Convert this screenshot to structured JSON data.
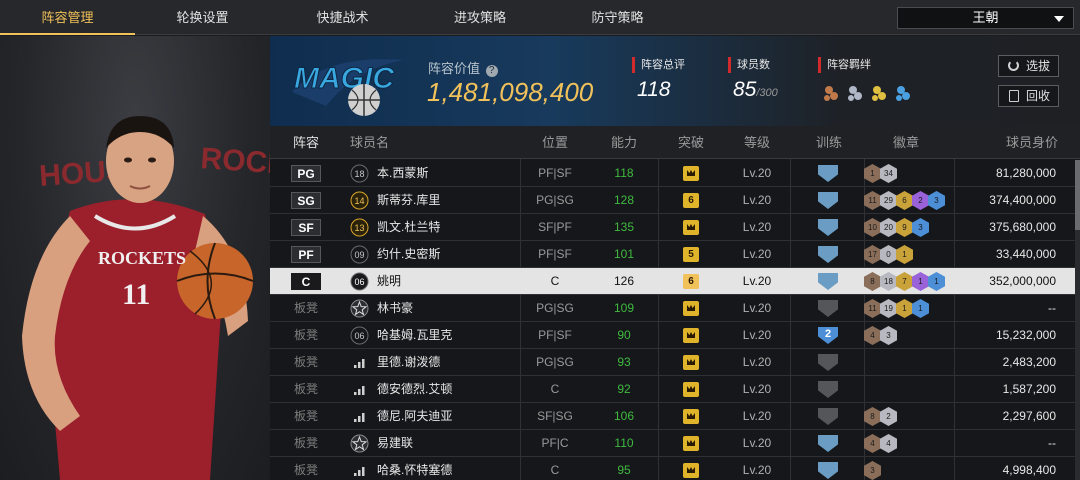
{
  "tabs": [
    {
      "label": "阵容管理",
      "active": true
    },
    {
      "label": "轮换设置",
      "active": false
    },
    {
      "label": "快捷战术",
      "active": false
    },
    {
      "label": "进攻策略",
      "active": false
    },
    {
      "label": "防守策略",
      "active": false
    }
  ],
  "team_select": {
    "value": "王朝"
  },
  "player_art": {
    "jersey_team": "ROCKETS",
    "jersey_number": "11",
    "backdrop_text_left": "HOUST",
    "backdrop_text_right": "ROCK"
  },
  "header": {
    "logo_text": "MAGIC",
    "lineup_value_label": "阵容价值",
    "lineup_value": "1,481,098,400",
    "total_rating_label": "阵容总评",
    "total_rating": "118",
    "player_count_label": "球员数",
    "player_count": "85",
    "player_count_max": "/300",
    "bonds_label": "阵容羁绊",
    "scout_button": "选拔",
    "recycle_button": "回收"
  },
  "columns": [
    "阵容",
    "球员名",
    "位置",
    "能力",
    "突破",
    "等级",
    "训练",
    "徽章",
    "球员身价"
  ],
  "rows": [
    {
      "slot": "PG",
      "num": "18",
      "name": "本.西蒙斯",
      "pos": "PF|SF",
      "ability": "118",
      "breakthrough": "",
      "level": "Lv.20",
      "training": "",
      "badges": [
        "1",
        "34"
      ],
      "value": "81,280,000",
      "selected": false,
      "starter": true,
      "num_style": "plain",
      "break_color": "#e0b42a",
      "train_color": "#6a9cc4",
      "badge_colors": [
        "#8a6e5a",
        "#b8b8c0"
      ]
    },
    {
      "slot": "SG",
      "num": "14",
      "name": "斯蒂芬.库里",
      "pos": "PG|SG",
      "ability": "128",
      "breakthrough": "6",
      "level": "Lv.20",
      "training": "",
      "badges": [
        "11",
        "29",
        "6",
        "2",
        "3"
      ],
      "value": "374,400,000",
      "selected": false,
      "starter": true,
      "num_style": "gold",
      "break_color": "#e0b42a",
      "train_color": "#6a9cc4",
      "badge_colors": [
        "#8a6e5a",
        "#b8b8c0",
        "#c9a23a",
        "#9a62d8",
        "#4c8fd6"
      ]
    },
    {
      "slot": "SF",
      "num": "13",
      "name": "凯文.杜兰特",
      "pos": "SF|PF",
      "ability": "135",
      "breakthrough": "",
      "level": "Lv.20",
      "training": "",
      "badges": [
        "10",
        "20",
        "9",
        "3"
      ],
      "value": "375,680,000",
      "selected": false,
      "starter": true,
      "num_style": "gold",
      "break_color": "#e0b42a",
      "train_color": "#6a9cc4",
      "badge_colors": [
        "#8a6e5a",
        "#b8b8c0",
        "#c9a23a",
        "#4c8fd6"
      ]
    },
    {
      "slot": "PF",
      "num": "09",
      "name": "约什.史密斯",
      "pos": "PF|SF",
      "ability": "101",
      "breakthrough": "5",
      "level": "Lv.20",
      "training": "",
      "badges": [
        "17",
        "0",
        "1"
      ],
      "value": "33,440,000",
      "selected": false,
      "starter": true,
      "num_style": "plain",
      "break_color": "#e0b42a",
      "train_color": "#6a9cc4",
      "badge_colors": [
        "#8a6e5a",
        "#b8b8c0",
        "#c9a23a"
      ]
    },
    {
      "slot": "C",
      "num": "06",
      "name": "姚明",
      "pos": "C",
      "ability": "126",
      "breakthrough": "6",
      "level": "Lv.20",
      "training": "",
      "badges": [
        "8",
        "18",
        "7",
        "1",
        "1"
      ],
      "value": "352,000,000",
      "selected": true,
      "starter": true,
      "num_style": "dark",
      "break_color": "#e0b42a",
      "train_color": "#6a9cc4",
      "badge_colors": [
        "#8a6e5a",
        "#b8b8c0",
        "#c9a23a",
        "#9a62d8",
        "#4c8fd6"
      ]
    },
    {
      "slot": "板凳",
      "num": "",
      "name": "林书豪",
      "pos": "PG|SG",
      "ability": "109",
      "breakthrough": "",
      "level": "Lv.20",
      "training": "",
      "badges": [
        "11",
        "19",
        "1",
        "1"
      ],
      "value": "--",
      "selected": false,
      "starter": false,
      "num_style": "star",
      "break_color": "#e0b42a",
      "train_color": "#555659",
      "badge_colors": [
        "#8a6e5a",
        "#b8b8c0",
        "#c9a23a",
        "#4c8fd6"
      ]
    },
    {
      "slot": "板凳",
      "num": "06",
      "name": "哈基姆.瓦里克",
      "pos": "PF|SF",
      "ability": "90",
      "breakthrough": "",
      "level": "Lv.20",
      "training": "2",
      "badges": [
        "4",
        "3"
      ],
      "value": "15,232,000",
      "selected": false,
      "starter": false,
      "num_style": "plain",
      "break_color": "#e0b42a",
      "train_color": "#4c8fd6",
      "badge_colors": [
        "#8a6e5a",
        "#b8b8c0"
      ]
    },
    {
      "slot": "板凳",
      "num": "",
      "name": "里德.谢泼德",
      "pos": "PG|SG",
      "ability": "93",
      "breakthrough": "",
      "level": "Lv.20",
      "training": "",
      "badges": [],
      "value": "2,483,200",
      "selected": false,
      "starter": false,
      "num_style": "bars",
      "break_color": "#e0b42a",
      "train_color": "#555659",
      "badge_colors": []
    },
    {
      "slot": "板凳",
      "num": "",
      "name": "德安德烈.艾顿",
      "pos": "C",
      "ability": "92",
      "breakthrough": "",
      "level": "Lv.20",
      "training": "",
      "badges": [],
      "value": "1,587,200",
      "selected": false,
      "starter": false,
      "num_style": "bars",
      "break_color": "#e0b42a",
      "train_color": "#555659",
      "badge_colors": []
    },
    {
      "slot": "板凳",
      "num": "",
      "name": "德尼.阿夫迪亚",
      "pos": "SF|SG",
      "ability": "106",
      "breakthrough": "",
      "level": "Lv.20",
      "training": "",
      "badges": [
        "8",
        "2"
      ],
      "value": "2,297,600",
      "selected": false,
      "starter": false,
      "num_style": "bars",
      "break_color": "#e0b42a",
      "train_color": "#555659",
      "badge_colors": [
        "#8a6e5a",
        "#b8b8c0"
      ]
    },
    {
      "slot": "板凳",
      "num": "",
      "name": "易建联",
      "pos": "PF|C",
      "ability": "110",
      "breakthrough": "",
      "level": "Lv.20",
      "training": "",
      "badges": [
        "4",
        "4"
      ],
      "value": "--",
      "selected": false,
      "starter": false,
      "num_style": "star",
      "break_color": "#e0b42a",
      "train_color": "#6a9cc4",
      "badge_colors": [
        "#8a6e5a",
        "#b8b8c0"
      ]
    },
    {
      "slot": "板凳",
      "num": "",
      "name": "哈桑.怀特塞德",
      "pos": "C",
      "ability": "95",
      "breakthrough": "",
      "level": "Lv.20",
      "training": "",
      "badges": [
        "3"
      ],
      "value": "4,998,400",
      "selected": false,
      "starter": false,
      "num_style": "bars",
      "break_color": "#e0b42a",
      "train_color": "#6a9cc4",
      "badge_colors": [
        "#8a6e5a"
      ]
    }
  ]
}
